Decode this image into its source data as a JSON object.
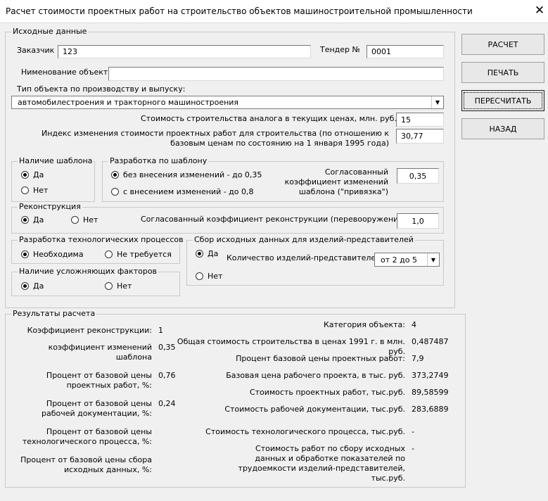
{
  "window": {
    "title": "Расчет стоимости проектных работ на строительство объектов машиностроительной промышленности",
    "close_glyph": "✕"
  },
  "input": {
    "legend": "Исходные данные",
    "customer": {
      "label": "Заказчик",
      "value": "123"
    },
    "tender": {
      "label": "Тендер №",
      "value": "0001"
    },
    "object_name": {
      "label": "Нименование объекта",
      "value": ""
    },
    "object_type": {
      "label": "Тип объекта по производству и выпуску:",
      "value": "автомобилестроения и тракторного машиностроения"
    },
    "analog_cost": {
      "label": "Стоимость строительства аналога в текущих ценах, млн. руб.:",
      "value": "15"
    },
    "index": {
      "label": "Индекс изменения стоимости проектных работ для строительства (по отношению к базовым ценам по состоянию на 1 января 1995 года)",
      "value": "30,77"
    },
    "template": {
      "legend": "Наличие шаблона",
      "yes": "Да",
      "no": "Нет",
      "selected": "yes"
    },
    "template_dev": {
      "legend": "Разработка по шаблону",
      "opt1": "без внесения изменений - до 0,35",
      "opt2": "с внесением изменений - до 0,8",
      "selected": "opt1",
      "coef_label": "Согласованный коэффициент изменений шаблона (\"привязка\")",
      "coef_value": "0,35"
    },
    "reconstruction": {
      "legend": "Реконструкция",
      "yes": "Да",
      "no": "Нет",
      "selected": "yes",
      "coef_label": "Согласованный коэффициент реконструкции (перевооружения)",
      "coef_value": "1,0"
    },
    "tech": {
      "legend": "Разработка технологических процессов",
      "opt1": "Необходима",
      "opt2": "Не требуется",
      "selected": "opt1"
    },
    "complicating": {
      "legend": "Наличие усложняющих факторов",
      "yes": "Да",
      "no": "Нет",
      "selected": "yes"
    },
    "collection": {
      "legend": "Сбор исходных данных для изделий-представителей",
      "yes": "Да",
      "no": "Нет",
      "selected": "yes",
      "qty_label": "Количество изделий-представителей",
      "qty_value": "от 2 до 5"
    }
  },
  "buttons": {
    "calc": "РАСЧЕТ",
    "print": "ПЕЧАТЬ",
    "recalc": "ПЕРЕСЧИТАТЬ",
    "back": "НАЗАД"
  },
  "results": {
    "legend": "Результаты расчета",
    "left": [
      {
        "label": "Коэффициент реконструкции:",
        "value": "1"
      },
      {
        "label": "коэффициент изменений шаблона",
        "value": "0,35"
      },
      {
        "label": "Процент от базовой цены проектных работ, %:",
        "value": "0,76"
      },
      {
        "label": "Процент от базовой цены рабочей документации, %:",
        "value": "0,24"
      },
      {
        "label": "Процент от базовой цены технологического процесса, %:",
        "value": ""
      },
      {
        "label": "Процент от базовой цены сбора исходных данных, %:",
        "value": ""
      }
    ],
    "right": [
      {
        "label": "Категория объекта:",
        "value": "4"
      },
      {
        "label": "Общая стоимость строительства в ценах 1991 г. в млн. руб.",
        "value": "0,487487"
      },
      {
        "label": "Процент базовой цены проектных работ:",
        "value": "7,9"
      },
      {
        "label": "Базовая цена рабочего проекта, в тыс. руб.",
        "value": "373,2749"
      },
      {
        "label": "Стоимость проектных работ, тыс.руб.",
        "value": "89,58599"
      },
      {
        "label": "Стоимость рабочей документации, тыс.руб.",
        "value": "283,6889"
      },
      {
        "label": "Стоимость  технологического процесса, тыс.руб.",
        "value": "-"
      },
      {
        "label": "Стоимость работ по сбору исходных данных и обработке показателей по трудоемкости изделий-представителей, тыс.руб.",
        "value": "-"
      }
    ]
  }
}
